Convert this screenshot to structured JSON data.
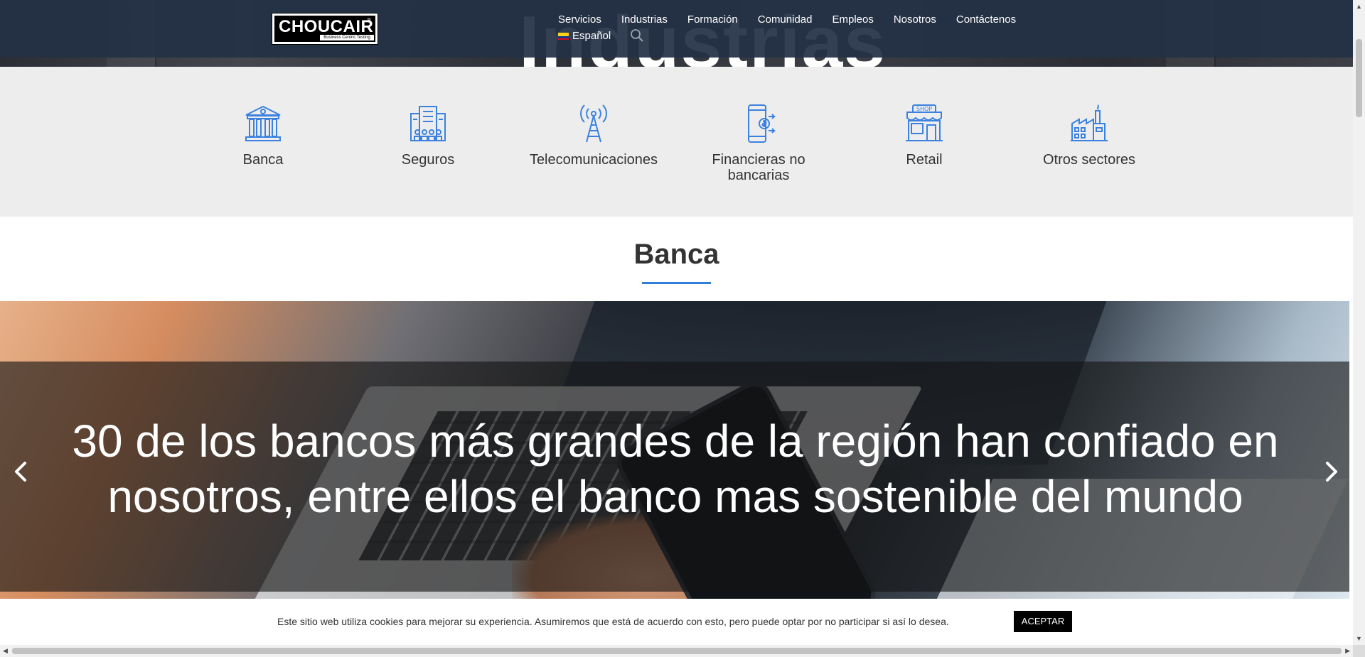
{
  "hero": {
    "background_word": "Industrias"
  },
  "header": {
    "logo": {
      "name": "CHOUCAIR",
      "registered": "®",
      "tagline": "Business Centric Testing"
    },
    "nav": [
      "Servicios",
      "Industrias",
      "Formación",
      "Comunidad",
      "Empleos",
      "Nosotros",
      "Contáctenos"
    ],
    "language": {
      "label": "Español",
      "flag": "colombia-flag"
    },
    "search_icon": "search-icon"
  },
  "industries": [
    {
      "label": "Banca",
      "icon": "bank-icon"
    },
    {
      "label": "Seguros",
      "icon": "insurance-building-icon"
    },
    {
      "label": "Telecomunicaciones",
      "icon": "antenna-tower-icon"
    },
    {
      "label": "Financieras no bancarias",
      "icon": "mobile-payment-icon"
    },
    {
      "label": "Retail",
      "icon": "shop-icon"
    },
    {
      "label": "Otros sectores",
      "icon": "factory-icon"
    }
  ],
  "section": {
    "title": "Banca"
  },
  "banner": {
    "text": "30 de los bancos más grandes de la región han confiado en nosotros, entre ellos el banco mas sostenible del mundo",
    "prev_icon": "chevron-left-icon",
    "next_icon": "chevron-right-icon"
  },
  "cookie": {
    "text": "Este sitio web utiliza cookies para mejorar su experiencia. Asumiremos que está de acuerdo con esto, pero puede optar por no participar si así lo desea.",
    "accept_label": "ACEPTAR"
  },
  "colors": {
    "header_bg": "#243045",
    "accent_blue": "#2f7fd6",
    "icon_blue": "#3b82e0",
    "industries_bg": "#ededed"
  }
}
